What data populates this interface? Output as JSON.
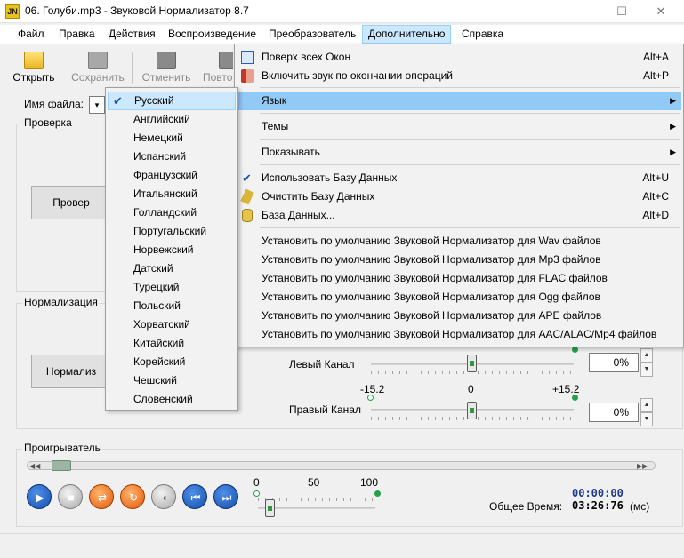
{
  "window": {
    "title": "06. Голуби.mp3 - Звуковой Нормализатор 8.7",
    "app_icon_text": "JN",
    "min": "—",
    "max": "☐",
    "close": "✕"
  },
  "menubar": [
    "Файл",
    "Правка",
    "Действия",
    "Воспроизведение",
    "Преобразователь",
    "Дополнительно",
    "Справка"
  ],
  "toolbar": {
    "open": "Открыть",
    "save": "Сохранить",
    "cancel": "Отменить",
    "repeat": "Повто"
  },
  "file": {
    "label": "Имя файла:"
  },
  "check_group": {
    "title": "Проверка",
    "button": "Провер"
  },
  "norm_group": {
    "title": "Нормализация",
    "button": "Нормализ"
  },
  "channels": {
    "left_label": "Левый Канал",
    "left_value": "0%",
    "right_label": "Правый Канал",
    "right_value": "0%",
    "scale_min": "-15.2",
    "scale_mid": "0",
    "scale_max": "+15.2"
  },
  "player": {
    "title": "Проигрыватель",
    "vol_min": "0",
    "vol_mid": "50",
    "vol_max": "100",
    "current_time": "00:00:00",
    "total_label": "Общее Время:",
    "total_time": "03:26:76",
    "total_unit": "(мс)",
    "volume": 0
  },
  "languages": [
    "Русский",
    "Английский",
    "Немецкий",
    "Испанский",
    "Французский",
    "Итальянский",
    "Голландский",
    "Португальский",
    "Норвежский",
    "Датский",
    "Турецкий",
    "Польский",
    "Хорватский",
    "Китайский",
    "Корейский",
    "Чешский",
    "Словенский"
  ],
  "advanced_menu": {
    "always_on_top": {
      "label": "Поверх всех Окон",
      "shortcut": "Alt+A"
    },
    "sound_on_finish": {
      "label": "Включить звук по окончании операций",
      "shortcut": "Alt+P"
    },
    "language": "Язык",
    "themes": "Темы",
    "show": "Показывать",
    "use_db": {
      "label": "Использовать Базу Данных",
      "shortcut": "Alt+U"
    },
    "clear_db": {
      "label": "Очистить Базу Данных",
      "shortcut": "Alt+C"
    },
    "database": {
      "label": "База Данных...",
      "shortcut": "Alt+D"
    },
    "defaults": [
      "Установить по умолчанию Звуковой Нормализатор для Wav файлов",
      "Установить по умолчанию Звуковой Нормализатор для Mp3 файлов",
      "Установить по умолчанию Звуковой Нормализатор для FLAC файлов",
      "Установить по умолчанию Звуковой Нормализатор для Ogg файлов",
      "Установить по умолчанию Звуковой Нормализатор для APE файлов",
      "Установить по умолчанию Звуковой Нормализатор для AAC/ALAC/Mp4 файлов"
    ]
  }
}
